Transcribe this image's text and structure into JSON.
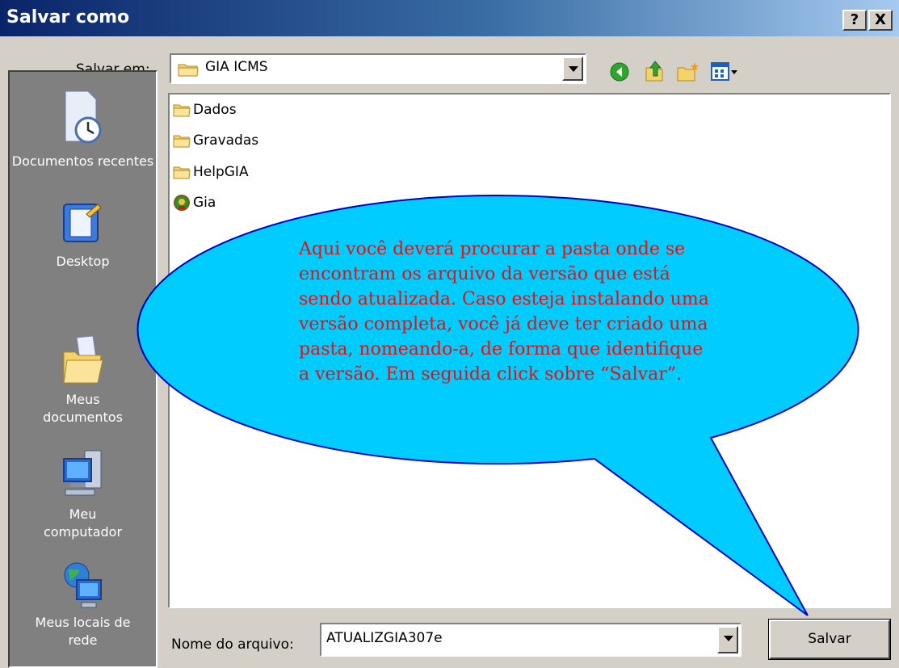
{
  "window": {
    "title": "Salvar como",
    "help_button": "?",
    "close_button": "X"
  },
  "location": {
    "label": "Salvar em:",
    "value": "GIA ICMS"
  },
  "toolbar": {
    "icons": [
      "back-icon",
      "up-folder-icon",
      "new-folder-icon",
      "view-menu-icon"
    ]
  },
  "places": [
    {
      "label": "Documentos recentes",
      "icon": "recent-documents-icon"
    },
    {
      "label": "Desktop",
      "icon": "desktop-icon"
    },
    {
      "label": "Meus documentos",
      "icon": "my-documents-icon"
    },
    {
      "label": "Meu computador",
      "icon": "my-computer-icon"
    },
    {
      "label": "Meus locais de rede",
      "icon": "network-places-icon"
    }
  ],
  "files": [
    {
      "name": "Dados",
      "icon": "folder-icon"
    },
    {
      "name": "Gravadas",
      "icon": "folder-icon"
    },
    {
      "name": "HelpGIA",
      "icon": "folder-icon"
    },
    {
      "name": "Gia",
      "icon": "gia-app-icon"
    }
  ],
  "callout": {
    "lines": [
      "Aqui você deverá procurar a pasta onde se",
      "encontram os arquivo da versão que está",
      "sendo atualizada. Caso esteja instalando uma",
      "versão completa, você já deve ter criado uma",
      "pasta, nomeando-a, de forma que identifique",
      "a versão. Em seguida click sobre “Salvar”."
    ]
  },
  "filename": {
    "label": "Nome do arquivo:",
    "value": "ATUALIZGIA307e"
  },
  "buttons": {
    "save": "Salvar"
  },
  "colors": {
    "callout_fill": "#00ccff",
    "callout_text": "#e81010",
    "callout_border": "#0000cc"
  }
}
